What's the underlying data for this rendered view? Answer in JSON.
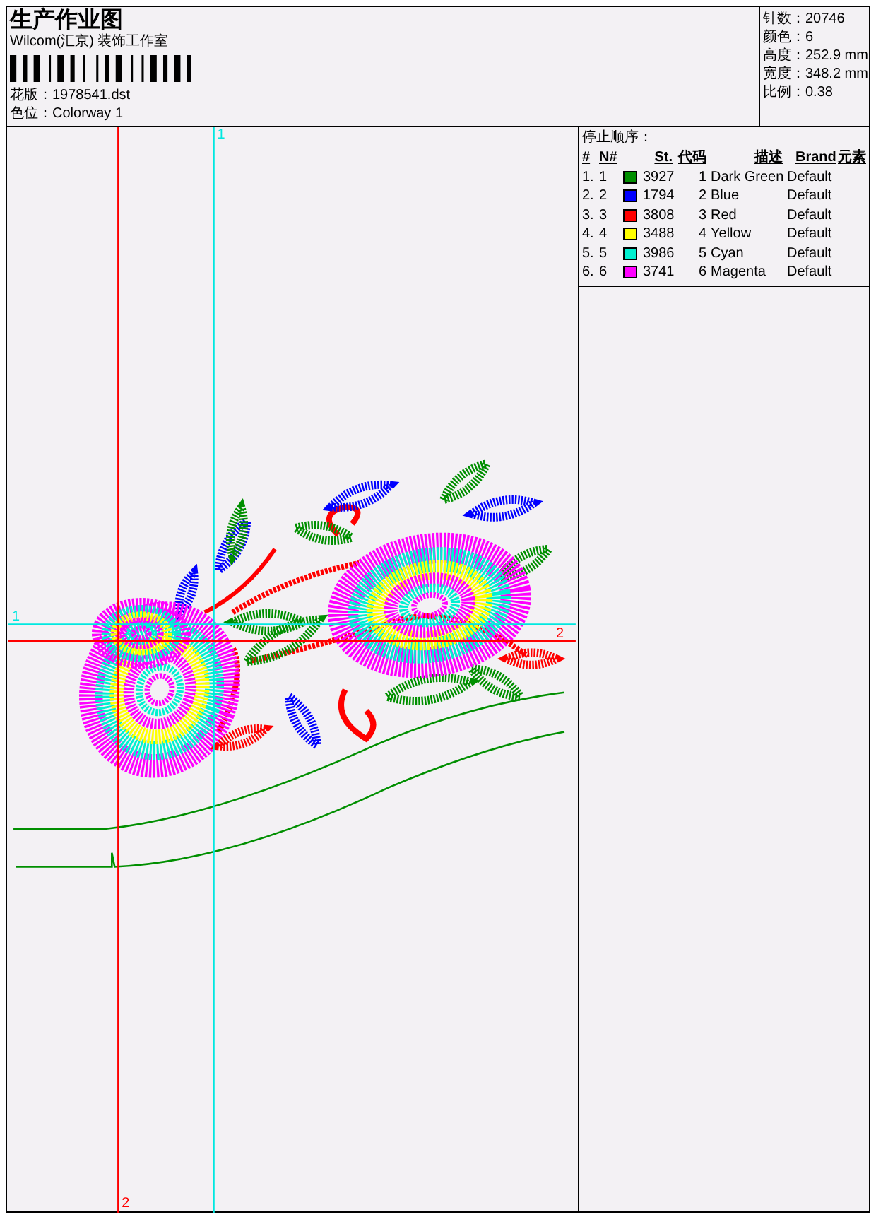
{
  "header": {
    "title": "生产作业图",
    "studio": "Wilcom(汇京) 装饰工作室",
    "fields": [
      {
        "label": "花版：",
        "value": "1978541.dst"
      },
      {
        "label": "色位：",
        "value": "Colorway 1"
      }
    ],
    "stats": [
      {
        "label": "针数：",
        "value": "20746"
      },
      {
        "label": "颜色：",
        "value": "6"
      },
      {
        "label": "高度：",
        "value": "252.9 mm"
      },
      {
        "label": "宽度：",
        "value": "348.2 mm"
      },
      {
        "label": "比例：",
        "value": "0.38"
      }
    ]
  },
  "canvas": {
    "guides": [
      {
        "label": "1",
        "color": "#00e8e0"
      },
      {
        "label": "2",
        "color": "#ff0000"
      },
      {
        "label": "1",
        "color": "#00e8e0"
      },
      {
        "label": "2",
        "color": "#ff0000"
      }
    ]
  },
  "stop_sequence": {
    "title": "停止顺序：",
    "columns": [
      "#",
      "N#",
      "St.",
      "代码",
      "描述",
      "Brand",
      "元素"
    ],
    "rows": [
      {
        "index": "1.",
        "n": "1",
        "color": "#008f00",
        "stitches": "3927",
        "code": "1",
        "description": "Dark Green",
        "brand": "Default"
      },
      {
        "index": "2.",
        "n": "2",
        "color": "#0000ff",
        "stitches": "1794",
        "code": "2",
        "description": "Blue",
        "brand": "Default"
      },
      {
        "index": "3.",
        "n": "3",
        "color": "#ff0000",
        "stitches": "3808",
        "code": "3",
        "description": "Red",
        "brand": "Default"
      },
      {
        "index": "4.",
        "n": "4",
        "color": "#ffff00",
        "stitches": "3488",
        "code": "4",
        "description": "Yellow",
        "brand": "Default"
      },
      {
        "index": "5.",
        "n": "5",
        "color": "#00f0d0",
        "stitches": "3986",
        "code": "5",
        "description": "Cyan",
        "brand": "Default"
      },
      {
        "index": "6.",
        "n": "6",
        "color": "#ff00ff",
        "stitches": "3741",
        "code": "6",
        "description": "Magenta",
        "brand": "Default"
      }
    ]
  }
}
